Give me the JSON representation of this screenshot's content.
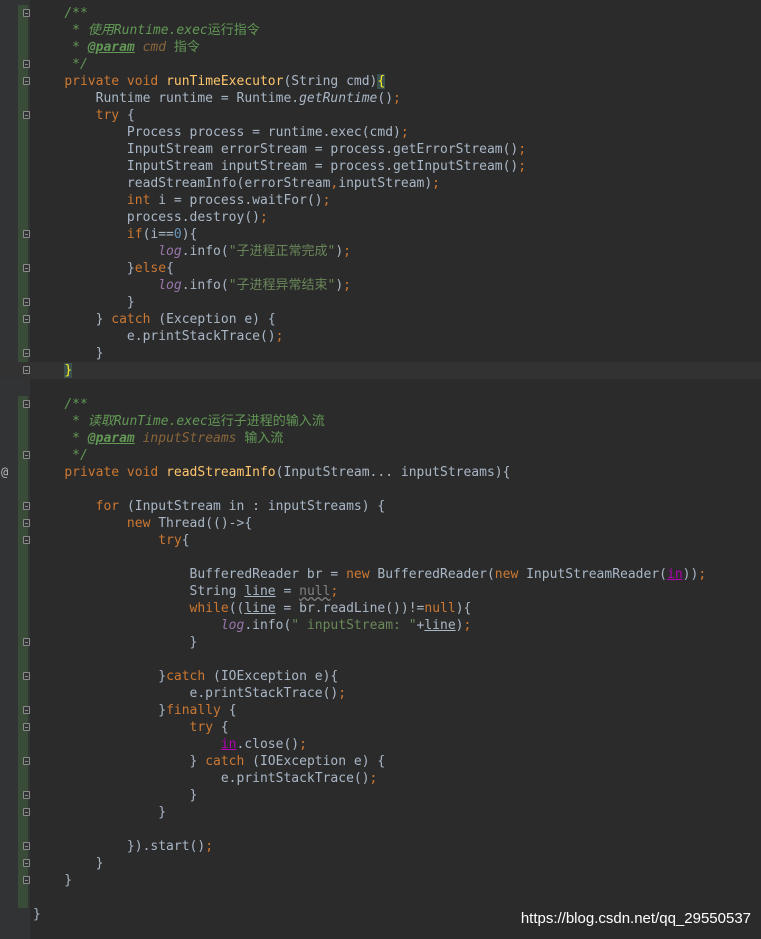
{
  "editor": {
    "language": "Java",
    "lines": [
      [
        {
          "t": "    "
        },
        {
          "t": "/**",
          "c": "doc"
        }
      ],
      [
        {
          "t": "     "
        },
        {
          "t": "* 使用",
          "c": "doc"
        },
        {
          "t": "Runtime.exec",
          "c": "doc"
        },
        {
          "t": "运行指令",
          "c": "doc-cn"
        }
      ],
      [
        {
          "t": "     "
        },
        {
          "t": "* ",
          "c": "doc"
        },
        {
          "t": "@param",
          "c": "doc-tag"
        },
        {
          "t": " cmd",
          "c": "doc-param"
        },
        {
          "t": " 指令",
          "c": "doc-cn"
        }
      ],
      [
        {
          "t": "     "
        },
        {
          "t": "*/",
          "c": "doc"
        }
      ],
      [
        {
          "t": "    "
        },
        {
          "t": "private void ",
          "c": "kw"
        },
        {
          "t": "runTimeExecutor",
          "c": "fn"
        },
        {
          "t": "(String cmd)"
        },
        {
          "t": "{",
          "c": "brace-hl"
        }
      ],
      [
        {
          "t": "        Runtime runtime = Runtime."
        },
        {
          "t": "getRuntime",
          "c": "italic"
        },
        {
          "t": "()"
        },
        {
          "t": ";",
          "c": "kw"
        }
      ],
      [
        {
          "t": "        "
        },
        {
          "t": "try ",
          "c": "kw"
        },
        {
          "t": "{"
        }
      ],
      [
        {
          "t": "            Process process = runtime.exec(cmd)"
        },
        {
          "t": ";",
          "c": "kw"
        }
      ],
      [
        {
          "t": "            InputStream errorStream = process.getErrorStream()"
        },
        {
          "t": ";",
          "c": "kw"
        }
      ],
      [
        {
          "t": "            InputStream inputStream = process.getInputStream()"
        },
        {
          "t": ";",
          "c": "kw"
        }
      ],
      [
        {
          "t": "            readStreamInfo(errorStream"
        },
        {
          "t": ",",
          "c": "kw"
        },
        {
          "t": "inputStream)"
        },
        {
          "t": ";",
          "c": "kw"
        }
      ],
      [
        {
          "t": "            "
        },
        {
          "t": "int ",
          "c": "kw"
        },
        {
          "t": "i = process.waitFor()"
        },
        {
          "t": ";",
          "c": "kw"
        }
      ],
      [
        {
          "t": "            process.destroy()"
        },
        {
          "t": ";",
          "c": "kw"
        }
      ],
      [
        {
          "t": "            "
        },
        {
          "t": "if",
          "c": "kw"
        },
        {
          "t": "(i=="
        },
        {
          "t": "0",
          "c": "num"
        },
        {
          "t": "){"
        }
      ],
      [
        {
          "t": "                "
        },
        {
          "t": "log",
          "c": "static"
        },
        {
          "t": ".info("
        },
        {
          "t": "\"子进程正常完成\"",
          "c": "str"
        },
        {
          "t": ")"
        },
        {
          "t": ";",
          "c": "kw"
        }
      ],
      [
        {
          "t": "            }"
        },
        {
          "t": "else",
          "c": "kw"
        },
        {
          "t": "{"
        }
      ],
      [
        {
          "t": "                "
        },
        {
          "t": "log",
          "c": "static"
        },
        {
          "t": ".info("
        },
        {
          "t": "\"子进程异常结束\"",
          "c": "str"
        },
        {
          "t": ")"
        },
        {
          "t": ";",
          "c": "kw"
        }
      ],
      [
        {
          "t": "            }"
        }
      ],
      [
        {
          "t": "        } "
        },
        {
          "t": "catch ",
          "c": "kw"
        },
        {
          "t": "(Exception e) {"
        }
      ],
      [
        {
          "t": "            e.printStackTrace()"
        },
        {
          "t": ";",
          "c": "kw"
        }
      ],
      [
        {
          "t": "        }"
        }
      ],
      [
        {
          "t": "    "
        },
        {
          "t": "}",
          "c": "brace-hl"
        }
      ],
      [
        {
          "t": ""
        }
      ],
      [
        {
          "t": "    "
        },
        {
          "t": "/**",
          "c": "doc"
        }
      ],
      [
        {
          "t": "     "
        },
        {
          "t": "* 读取",
          "c": "doc"
        },
        {
          "t": "RunTime.exec",
          "c": "doc"
        },
        {
          "t": "运行子进程的输入流",
          "c": "doc-cn"
        }
      ],
      [
        {
          "t": "     "
        },
        {
          "t": "* ",
          "c": "doc"
        },
        {
          "t": "@param",
          "c": "doc-tag"
        },
        {
          "t": " inputStreams",
          "c": "doc-param"
        },
        {
          "t": " 输入流",
          "c": "doc-cn"
        }
      ],
      [
        {
          "t": "     "
        },
        {
          "t": "*/",
          "c": "doc"
        }
      ],
      [
        {
          "t": "    "
        },
        {
          "t": "private void ",
          "c": "kw"
        },
        {
          "t": "readStreamInfo",
          "c": "fn"
        },
        {
          "t": "(InputStream... inputStreams){"
        }
      ],
      [
        {
          "t": ""
        }
      ],
      [
        {
          "t": "        "
        },
        {
          "t": "for ",
          "c": "kw"
        },
        {
          "t": "(InputStream in : inputStreams) {"
        }
      ],
      [
        {
          "t": "            "
        },
        {
          "t": "new ",
          "c": "kw"
        },
        {
          "t": "Thread(()->{"
        }
      ],
      [
        {
          "t": "                "
        },
        {
          "t": "try",
          "c": "kw"
        },
        {
          "t": "{"
        }
      ],
      [
        {
          "t": ""
        }
      ],
      [
        {
          "t": "                    BufferedReader br = "
        },
        {
          "t": "new ",
          "c": "kw"
        },
        {
          "t": "BufferedReader("
        },
        {
          "t": "new ",
          "c": "kw"
        },
        {
          "t": "InputStreamReader("
        },
        {
          "t": "in",
          "c": "var-in"
        },
        {
          "t": "))"
        },
        {
          "t": ";",
          "c": "kw"
        }
      ],
      [
        {
          "t": "                    String "
        },
        {
          "t": "line",
          "c": "ul"
        },
        {
          "t": " = "
        },
        {
          "t": "null",
          "c": "null-weak"
        },
        {
          "t": ";",
          "c": "kw"
        }
      ],
      [
        {
          "t": "                    "
        },
        {
          "t": "while",
          "c": "kw"
        },
        {
          "t": "(("
        },
        {
          "t": "line",
          "c": "ul"
        },
        {
          "t": " = br.readLine())!="
        },
        {
          "t": "null",
          "c": "kw"
        },
        {
          "t": "){"
        }
      ],
      [
        {
          "t": "                        "
        },
        {
          "t": "log",
          "c": "static"
        },
        {
          "t": ".info("
        },
        {
          "t": "\" inputStream: \"",
          "c": "str"
        },
        {
          "t": "+"
        },
        {
          "t": "line",
          "c": "ul"
        },
        {
          "t": ")"
        },
        {
          "t": ";",
          "c": "kw"
        }
      ],
      [
        {
          "t": "                    }"
        }
      ],
      [
        {
          "t": ""
        }
      ],
      [
        {
          "t": "                }"
        },
        {
          "t": "catch ",
          "c": "kw"
        },
        {
          "t": "(IOException e){"
        }
      ],
      [
        {
          "t": "                    e.printStackTrace()"
        },
        {
          "t": ";",
          "c": "kw"
        }
      ],
      [
        {
          "t": "                }"
        },
        {
          "t": "finally ",
          "c": "kw"
        },
        {
          "t": "{"
        }
      ],
      [
        {
          "t": "                    "
        },
        {
          "t": "try ",
          "c": "kw"
        },
        {
          "t": "{"
        }
      ],
      [
        {
          "t": "                        "
        },
        {
          "t": "in",
          "c": "var-in"
        },
        {
          "t": ".close()"
        },
        {
          "t": ";",
          "c": "kw"
        }
      ],
      [
        {
          "t": "                    } "
        },
        {
          "t": "catch ",
          "c": "kw"
        },
        {
          "t": "(IOException e) {"
        }
      ],
      [
        {
          "t": "                        e.printStackTrace()"
        },
        {
          "t": ";",
          "c": "kw"
        }
      ],
      [
        {
          "t": "                    }"
        }
      ],
      [
        {
          "t": "                }"
        }
      ],
      [
        {
          "t": ""
        }
      ],
      [
        {
          "t": "            })."
        },
        {
          "t": "start()"
        },
        {
          "t": ";",
          "c": "kw"
        }
      ],
      [
        {
          "t": "        }"
        }
      ],
      [
        {
          "t": "    }"
        }
      ],
      [
        {
          "t": ""
        }
      ],
      [
        {
          "t": "}"
        }
      ]
    ],
    "fold_markers": [
      0,
      3,
      4,
      6,
      13,
      15,
      17,
      18,
      20,
      21,
      23,
      26,
      29,
      30,
      31,
      37,
      39,
      41,
      42,
      44,
      46,
      47,
      49,
      50,
      51
    ],
    "override_marker_line": 27,
    "override_marker": "@",
    "current_line": 21
  },
  "watermark": "https://blog.csdn.net/qq_29550537"
}
